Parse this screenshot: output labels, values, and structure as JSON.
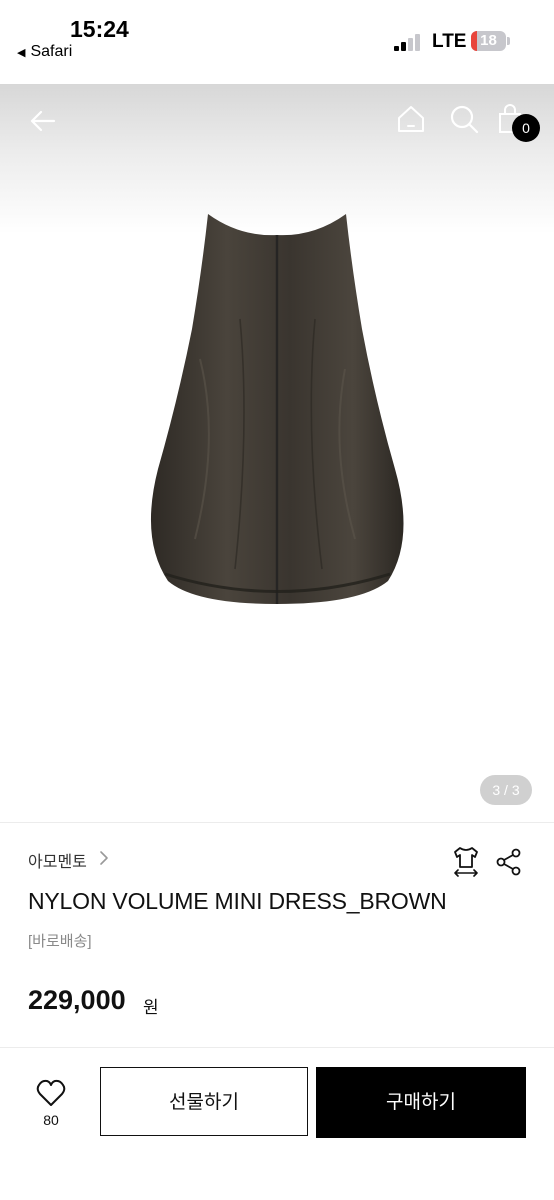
{
  "status_bar": {
    "time": "15:24",
    "back_app": "Safari",
    "network": "LTE",
    "battery": "18",
    "battery_level": 0.18
  },
  "nav": {
    "icons": [
      "back-arrow-icon",
      "home-icon",
      "search-icon",
      "shopping-bag-icon"
    ],
    "cart_count": "0"
  },
  "gallery": {
    "counter": "3 / 3",
    "product_image": "dress-image"
  },
  "product": {
    "brand": "아모멘토",
    "name": "NYLON VOLUME MINI DRESS_BROWN",
    "shipping_tag": "[바로배송]",
    "price": "229,000",
    "price_unit": "원"
  },
  "bottom_bar": {
    "like_count": "80",
    "gift_label": "선물하기",
    "buy_label": "구매하기"
  },
  "colors": {
    "accent": "#000000",
    "battery_low": "#e8453c",
    "dress": "#3f3a33",
    "muted_text": "#8a8a8a"
  }
}
